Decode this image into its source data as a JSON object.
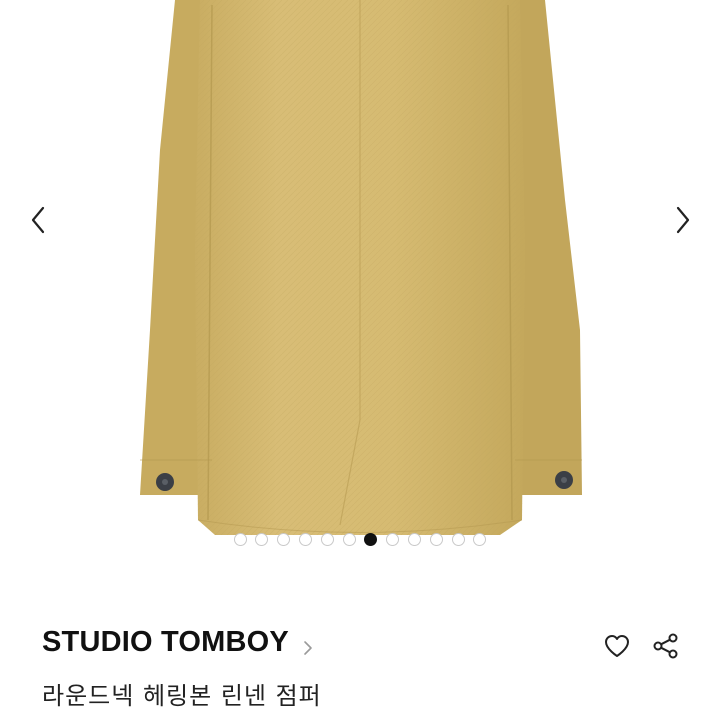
{
  "gallery": {
    "image_description_icon": "jacket-photo",
    "prev_icon": "chevron-left-icon",
    "next_icon": "chevron-right-icon",
    "total_slides": 12,
    "active_slide": 7
  },
  "product": {
    "brand": "STUDIO TOMBOY",
    "title": "라운드넥 헤링본 린넨 점퍼"
  },
  "actions": {
    "like_icon": "heart-icon",
    "share_icon": "share-icon"
  },
  "colors": {
    "jacket": "#d3b76f",
    "text": "#111111",
    "dot_active": "#111111",
    "dot_inactive_border": "#c9c9c9"
  }
}
